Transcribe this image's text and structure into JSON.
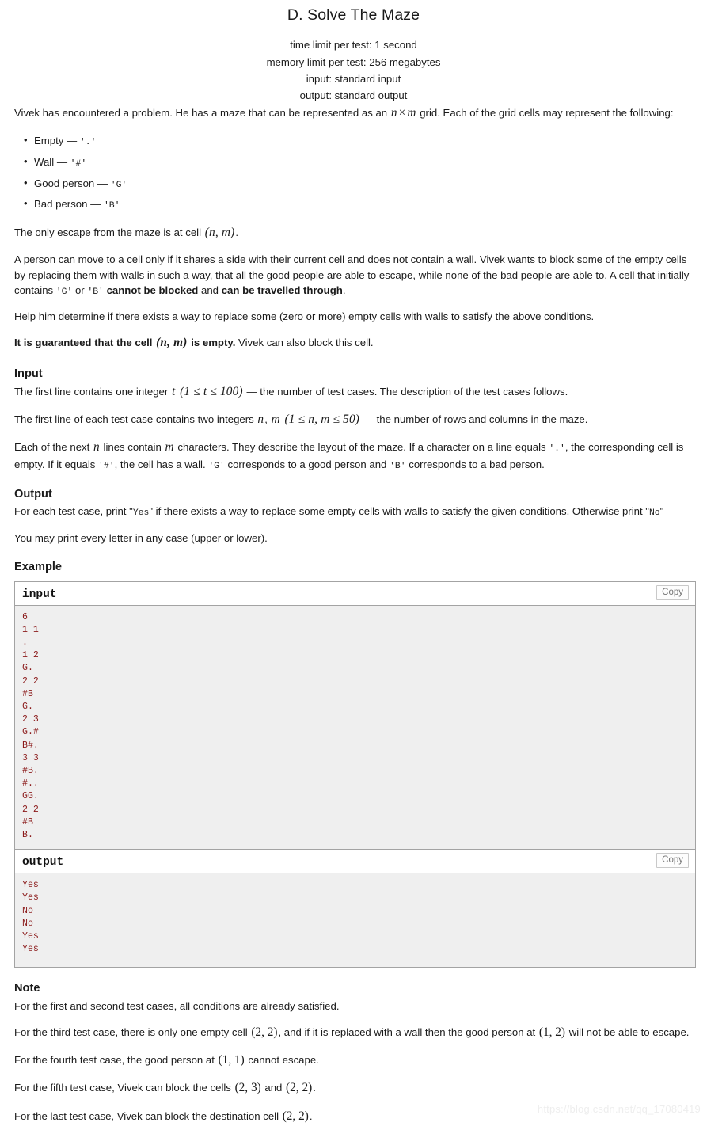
{
  "header": {
    "title": "D. Solve The Maze",
    "time_limit": "time limit per test: 1 second",
    "memory_limit": "memory limit per test: 256 megabytes",
    "input_spec": "input: standard input",
    "output_spec": "output: standard output"
  },
  "statement": {
    "intro_a": "Vivek has encountered a problem. He has a maze that can be represented as an ",
    "intro_math_n": "n",
    "intro_math_times": "×",
    "intro_math_m": "m",
    "intro_b": " grid. Each of the grid cells may represent the following:",
    "bullets": [
      {
        "label": "Empty — ",
        "literal": "'.'"
      },
      {
        "label": "Wall — ",
        "literal": "'#'"
      },
      {
        "label": "Good person  — ",
        "literal": "'G'"
      },
      {
        "label": "Bad person — ",
        "literal": "'B'"
      }
    ],
    "escape_a": "The only escape from the maze is at cell ",
    "escape_cell": "(n, m)",
    "escape_b": ".",
    "move_a": "A person can move to a cell only if it shares a side with their current cell and does not contain a wall. Vivek wants to block some of the empty cells by replacing them with walls in such a way, that all the good people are able to escape, while none of the bad people are able to. A cell that initially contains ",
    "move_lit_g": "'G'",
    "move_mid": " or ",
    "move_lit_b": "'B'",
    "move_b": " ",
    "move_bold1": "cannot be blocked",
    "move_c": " and ",
    "move_bold2": "can be travelled through",
    "move_d": ".",
    "help": "Help him determine if there exists a way to replace some (zero or more) empty cells with walls to satisfy the above conditions.",
    "guarantee_bold_a": "It is guaranteed that the cell ",
    "guarantee_cell": "(n, m)",
    "guarantee_bold_b": " is empty.",
    "guarantee_rest": " Vivek can also block this cell."
  },
  "input_section": {
    "heading": "Input",
    "p1_a": "The first line contains one integer ",
    "p1_t": "t",
    "p1_range": "(1 ≤ t ≤ 100)",
    "p1_b": " — the number of test cases. The description of the test cases follows.",
    "p2_a": "The first line of each test case contains two integers ",
    "p2_n": "n",
    "p2_comma": ", ",
    "p2_m": "m",
    "p2_range": "(1 ≤ n, m ≤ 50)",
    "p2_b": " — the number of rows and columns in the maze.",
    "p3_a": "Each of the next ",
    "p3_n": "n",
    "p3_b": " lines contain ",
    "p3_m": "m",
    "p3_c": " characters. They describe the layout of the maze. If a character on a line equals ",
    "p3_lit_dot": "'.'",
    "p3_d": ", the corresponding cell is empty. If it equals ",
    "p3_lit_hash": "'#'",
    "p3_e": ", the cell has a wall. ",
    "p3_lit_g": "'G'",
    "p3_f": " corresponds to a good person and ",
    "p3_lit_b": "'B'",
    "p3_g": " corresponds to a bad person."
  },
  "output_section": {
    "heading": "Output",
    "p1_a": "For each test case, print \"",
    "p1_yes": "Yes",
    "p1_b": "\" if there exists a way to replace some empty cells with walls to satisfy the given conditions. Otherwise print \"",
    "p1_no": "No",
    "p1_c": "\"",
    "p2": "You may print every letter in any case (upper or lower)."
  },
  "example": {
    "heading": "Example",
    "input_label": "input",
    "output_label": "output",
    "copy_label": "Copy",
    "input_data": "6\n1 1\n.\n1 2\nG.\n2 2\n#B\nG.\n2 3\nG.#\nB#.\n3 3\n#B.\n#..\nGG.\n2 2\n#B\nB.",
    "output_data": "Yes\nYes\nNo\nNo\nYes\nYes"
  },
  "note": {
    "heading": "Note",
    "p1": "For the first and second test cases, all conditions are already satisfied.",
    "p2_a": "For the third test case, there is only one empty cell ",
    "p2_cell1": "(2, 2)",
    "p2_b": ", and if it is replaced with a wall then the good person at ",
    "p2_cell2": "(1, 2)",
    "p2_c": " will not be able to escape.",
    "p3_a": "For the fourth test case, the good person at ",
    "p3_cell": "(1, 1)",
    "p3_b": " cannot escape.",
    "p4_a": "For the fifth test case, Vivek can block the cells ",
    "p4_cell1": "(2, 3)",
    "p4_b": " and ",
    "p4_cell2": "(2, 2)",
    "p4_c": ".",
    "p5_a": "For the last test case, Vivek can block the destination cell ",
    "p5_cell": "(2, 2)",
    "p5_b": "."
  },
  "watermark": "https://blog.csdn.net/qq_17080419",
  "colors": {
    "sample_text": "#8b1a1a",
    "sample_bg": "#efefef",
    "border": "#a3a3a3"
  }
}
